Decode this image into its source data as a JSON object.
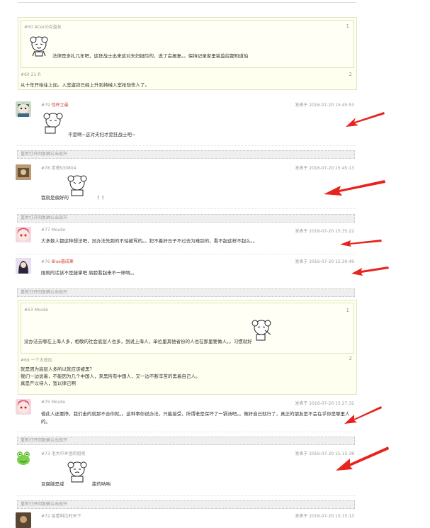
{
  "quote1": {
    "inner_meta": "#50 ACer/0女盗友",
    "inner_num": "1",
    "inner_text": "法律是多扎几年吧，这狂战士出来这对夫妇挺险的，说了会报复。。保持记录家里装监控都知道怕",
    "outer_meta": "#60 21-R",
    "outer_num": "2",
    "outer_text": "从十年开始往上加。入室盗窃已经上升到持械入室抢劫伤人了。"
  },
  "post79": {
    "meta": "#79",
    "user": "怪杯之最",
    "time": "发表于 2016-07-20 15:45:53",
    "text": "不是啊~这对夫妇才是狂战士吧~"
  },
  "collapse_label": "重新打开回复确认出现开",
  "post78": {
    "meta": "#78 老爸930804",
    "time": "发表于 2016-07-20 15:45:13",
    "text1": "我就是偏好的",
    "text2": "！！"
  },
  "post77": {
    "meta": "#77 Mouko",
    "time": "发表于 2016-07-20 15:35:22",
    "text": "大多数人都这种想法吧，没办法先跑的不怕被骂的。。犯不着好日子不过去为难别的，看不起这样不起么。。"
  },
  "post76": {
    "meta": "#76",
    "user": "Blue暮成寒",
    "time": "发表于 2016-07-20 15:30:49",
    "text": "围观的话该不是鼓掌吧 肩膀看起来不一样啊。。"
  },
  "quote2": {
    "inner_meta": "#53 Mouko",
    "inner_num": "1",
    "inner_text": "没办法去哪在上海人多，相敬的社会底层人也多，到说上海人，单位里其他省份的人也在那里要做人。。习惯就好",
    "outer_meta": "#69 一个太遥远",
    "outer_num": "2",
    "outer_line1": "就是因为底层人多所以就应该被黑？",
    "outer_line2": "我们一边说着，不能因为几个中国人，来黑所有中国人，又一边不断辛苦的黑着自己人。",
    "outer_line3": "真是严以待人，宽以律己啊"
  },
  "post75": {
    "meta": "#75 Mouko",
    "time": "发表于 2016-07-20 15:27:32",
    "text1": "借此人还要挣，我们走的就那不合你就。。这种事你说办法，只能接受，所谓老是保坏了一锅汤吧。。做好自己就行了，真正的朋友是不会在乎你是哪里人",
    "text2": "的。"
  },
  "post73": {
    "meta": "#73 毛大中乡团的组呢",
    "time": "发表于 2016-07-20 15:15:38",
    "text1": "豆腐脑是咸",
    "text2": "甜的呐呐"
  },
  "post72": {
    "meta": "#72 层看科比时天下",
    "time": "发表于 2016-07-20 15:15:13"
  },
  "colors": {
    "arrow": "#e8231d",
    "username_red": "#d0463c",
    "quote_bg": "#fffff0"
  }
}
